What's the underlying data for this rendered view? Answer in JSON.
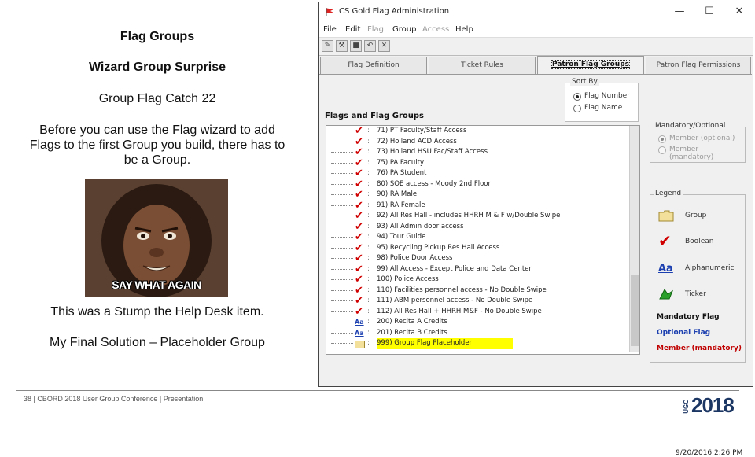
{
  "slide": {
    "title": "Flag Groups",
    "subtitle": "Wizard Group Surprise",
    "catch": "Group Flag Catch 22",
    "paragraph": "Before you can use the Flag wizard to add Flags to the first Group you build, there has to be a Group.",
    "meme_caption": "SAY WHAT AGAIN",
    "stump": "This was a Stump the Help Desk item.",
    "solution": "My Final Solution – Placeholder Group",
    "footer": "38 | CBORD 2018 User Group Conference | Presentation",
    "logo_ugc": "UGC",
    "logo_year": "2018"
  },
  "window": {
    "title": "CS Gold Flag Administration",
    "controls": {
      "minimize": "—",
      "maximize": "☐",
      "close": "✕"
    },
    "menus": [
      {
        "label": "File",
        "enabled": true
      },
      {
        "label": "Edit",
        "enabled": true
      },
      {
        "label": "Flag",
        "enabled": false
      },
      {
        "label": "Group",
        "enabled": true
      },
      {
        "label": "Access",
        "enabled": false
      },
      {
        "label": "Help",
        "enabled": true
      }
    ],
    "tabs": [
      {
        "label": "Flag Definition",
        "active": false
      },
      {
        "label": "Ticket Rules",
        "active": false
      },
      {
        "label": "Patron Flag Groups",
        "active": true
      },
      {
        "label": "Patron Flag Permissions",
        "active": false
      }
    ],
    "sort_by": {
      "label": "Sort By",
      "options": [
        "Flag Number",
        "Flag Name"
      ],
      "selected": "Flag Number"
    },
    "flags_label": "Flags and Flag Groups",
    "flags": [
      {
        "icon": "check",
        "text": "71) PT Faculty/Staff Access"
      },
      {
        "icon": "check",
        "text": "72) Holland ACD Access"
      },
      {
        "icon": "check",
        "text": "73) Holland HSU Fac/Staff Access"
      },
      {
        "icon": "check",
        "text": "75) PA Faculty"
      },
      {
        "icon": "check",
        "text": "76) PA Student"
      },
      {
        "icon": "check",
        "text": "80) SOE access - Moody 2nd Floor"
      },
      {
        "icon": "check",
        "text": "90) RA Male"
      },
      {
        "icon": "check",
        "text": "91) RA Female"
      },
      {
        "icon": "check",
        "text": "92) All Res Hall - includes HHRH M & F w/Double Swipe"
      },
      {
        "icon": "check",
        "text": "93) All Admin door access"
      },
      {
        "icon": "check",
        "text": "94) Tour Guide"
      },
      {
        "icon": "check",
        "text": "95) Recycling Pickup Res Hall Access"
      },
      {
        "icon": "check",
        "text": "98) Police Door Access"
      },
      {
        "icon": "check",
        "text": "99) All Access - Except Police and Data Center"
      },
      {
        "icon": "check",
        "text": "100) Police Access"
      },
      {
        "icon": "check",
        "text": "110) Facilities personnel access - No Double Swipe"
      },
      {
        "icon": "check",
        "text": "111) ABM personnel access - No Double Swipe"
      },
      {
        "icon": "check",
        "text": "112) All Res Hall + HHRH M&F - No Double Swipe"
      },
      {
        "icon": "alpha",
        "text": "200) Recita A Credits"
      },
      {
        "icon": "alpha",
        "text": "201) Recita B Credits"
      },
      {
        "icon": "folder",
        "text": "999) Group Flag Placeholder",
        "highlight": true
      }
    ],
    "alpha_symbol": "Aa",
    "mandatory": {
      "label": "Mandatory/Optional",
      "options": [
        "Member (optional)",
        "Member (mandatory)"
      ],
      "selected": "Member (optional)"
    },
    "legend": {
      "label": "Legend",
      "items": [
        {
          "icon": "folder",
          "text": "Group"
        },
        {
          "icon": "check",
          "text": "Boolean"
        },
        {
          "icon": "alpha",
          "text": "Alphanumeric"
        },
        {
          "icon": "ticker",
          "text": "Ticker"
        }
      ],
      "mandatory_flag": "Mandatory Flag",
      "optional_flag": "Optional Flag",
      "member_mandatory": "Member (mandatory)",
      "colors": {
        "mandatory_flag": "#111111",
        "optional_flag": "#1c3fb0",
        "member_mandatory": "#c00000"
      }
    },
    "status_time": "9/20/2016  2:26 PM"
  }
}
